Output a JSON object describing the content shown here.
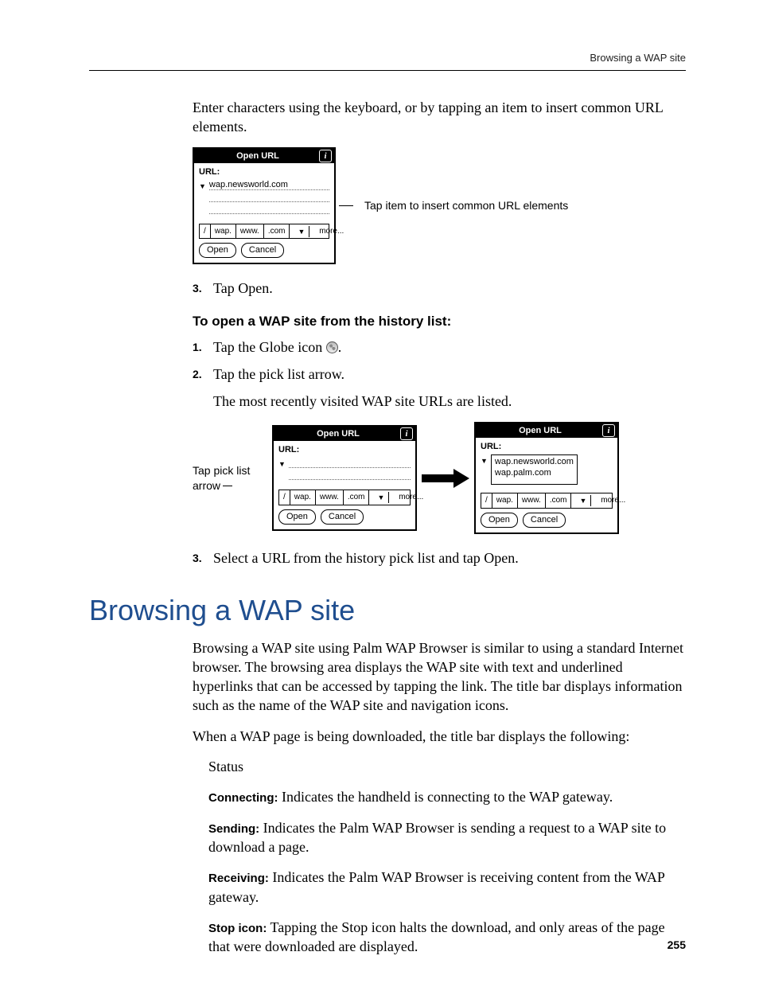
{
  "runhead": "Browsing a WAP site",
  "intro": "Enter characters using the keyboard, or by tapping an item to insert common URL elements.",
  "fig1": {
    "title": "Open URL",
    "urlLabel": "URL:",
    "urlValue": "wap.newsworld.com",
    "shortcuts": {
      "slash": "/",
      "wap": "wap.",
      "www": "www.",
      "com": ".com",
      "more": "more..."
    },
    "open": "Open",
    "cancel": "Cancel",
    "callout": "Tap item to insert common URL elements"
  },
  "step3a": {
    "num": "3.",
    "text": "Tap Open."
  },
  "subhead": "To open a WAP site from the history list:",
  "step1": {
    "num": "1.",
    "text": "Tap the Globe icon "
  },
  "step2": {
    "num": "2.",
    "text": "Tap the pick list arrow."
  },
  "step2_para": "The most recently visited WAP site URLs are listed.",
  "fig2": {
    "captionLeft": "Tap pick list arrow",
    "title": "Open URL",
    "urlLabel": "URL:",
    "shortcuts": {
      "slash": "/",
      "wap": "wap.",
      "www": "www.",
      "com": ".com",
      "more": "more..."
    },
    "open": "Open",
    "cancel": "Cancel"
  },
  "fig3": {
    "title": "Open URL",
    "urlLabel": "URL:",
    "history": [
      "wap.newsworld.com",
      "wap.palm.com"
    ],
    "shortcuts": {
      "slash": "/",
      "wap": "wap.",
      "www": "www.",
      "com": ".com",
      "more": "more..."
    },
    "open": "Open",
    "cancel": "Cancel"
  },
  "step3b": {
    "num": "3.",
    "text": "Select a URL from the history pick list and tap Open."
  },
  "h1": "Browsing a WAP site",
  "p1": "Browsing a WAP site using Palm WAP Browser is similar to using a standard Internet browser. The browsing area displays the WAP site with text and underlined hyperlinks that can be accessed by tapping the link. The title bar displays information such as the name of the WAP site and navigation icons.",
  "p2": "When a WAP page is being downloaded, the title bar displays the following:",
  "statusLabel": "Status",
  "defs": {
    "connecting": {
      "label": "Connecting:",
      "text": " Indicates the handheld is connecting to the WAP gateway."
    },
    "sending": {
      "label": "Sending:",
      "text": " Indicates the Palm WAP Browser is sending a request to a WAP site to download a page."
    },
    "receiving": {
      "label": "Receiving:",
      "text": " Indicates the Palm WAP Browser is receiving content from the WAP gateway."
    },
    "stop": {
      "label": "Stop icon:",
      "text": " Tapping the Stop icon halts the download, and only areas of the page that were downloaded are displayed."
    }
  },
  "pageNumber": "255"
}
